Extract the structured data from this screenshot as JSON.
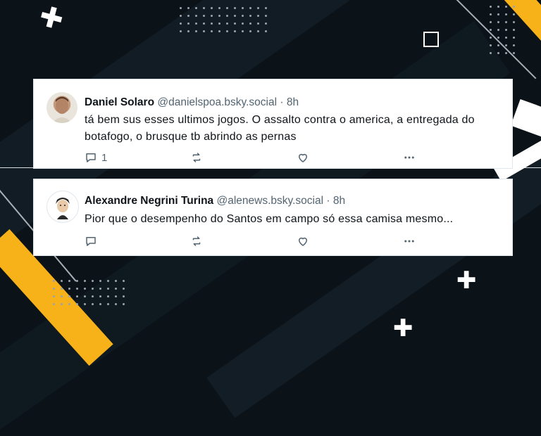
{
  "posts": [
    {
      "name": "Daniel Solaro",
      "handle": "@danielspoa.bsky.social",
      "time": "· 8h",
      "text": "tá bem sus esses ultimos jogos. O assalto contra o america, a entregada do botafogo, o brusque tb abrindo as pernas",
      "reply_count": "1"
    },
    {
      "name": "Alexandre Negrini Turina",
      "handle": "@alenews.bsky.social",
      "time": "· 8h",
      "text": "Pior que o desempenho do Santos em campo só essa camisa mesmo...",
      "reply_count": ""
    }
  ],
  "icons": [
    "reply-icon",
    "repost-icon",
    "like-icon",
    "more-icon"
  ],
  "colors": {
    "accent_yellow": "#f7b21a",
    "background": "#0b1218",
    "text_secondary": "#536471"
  }
}
